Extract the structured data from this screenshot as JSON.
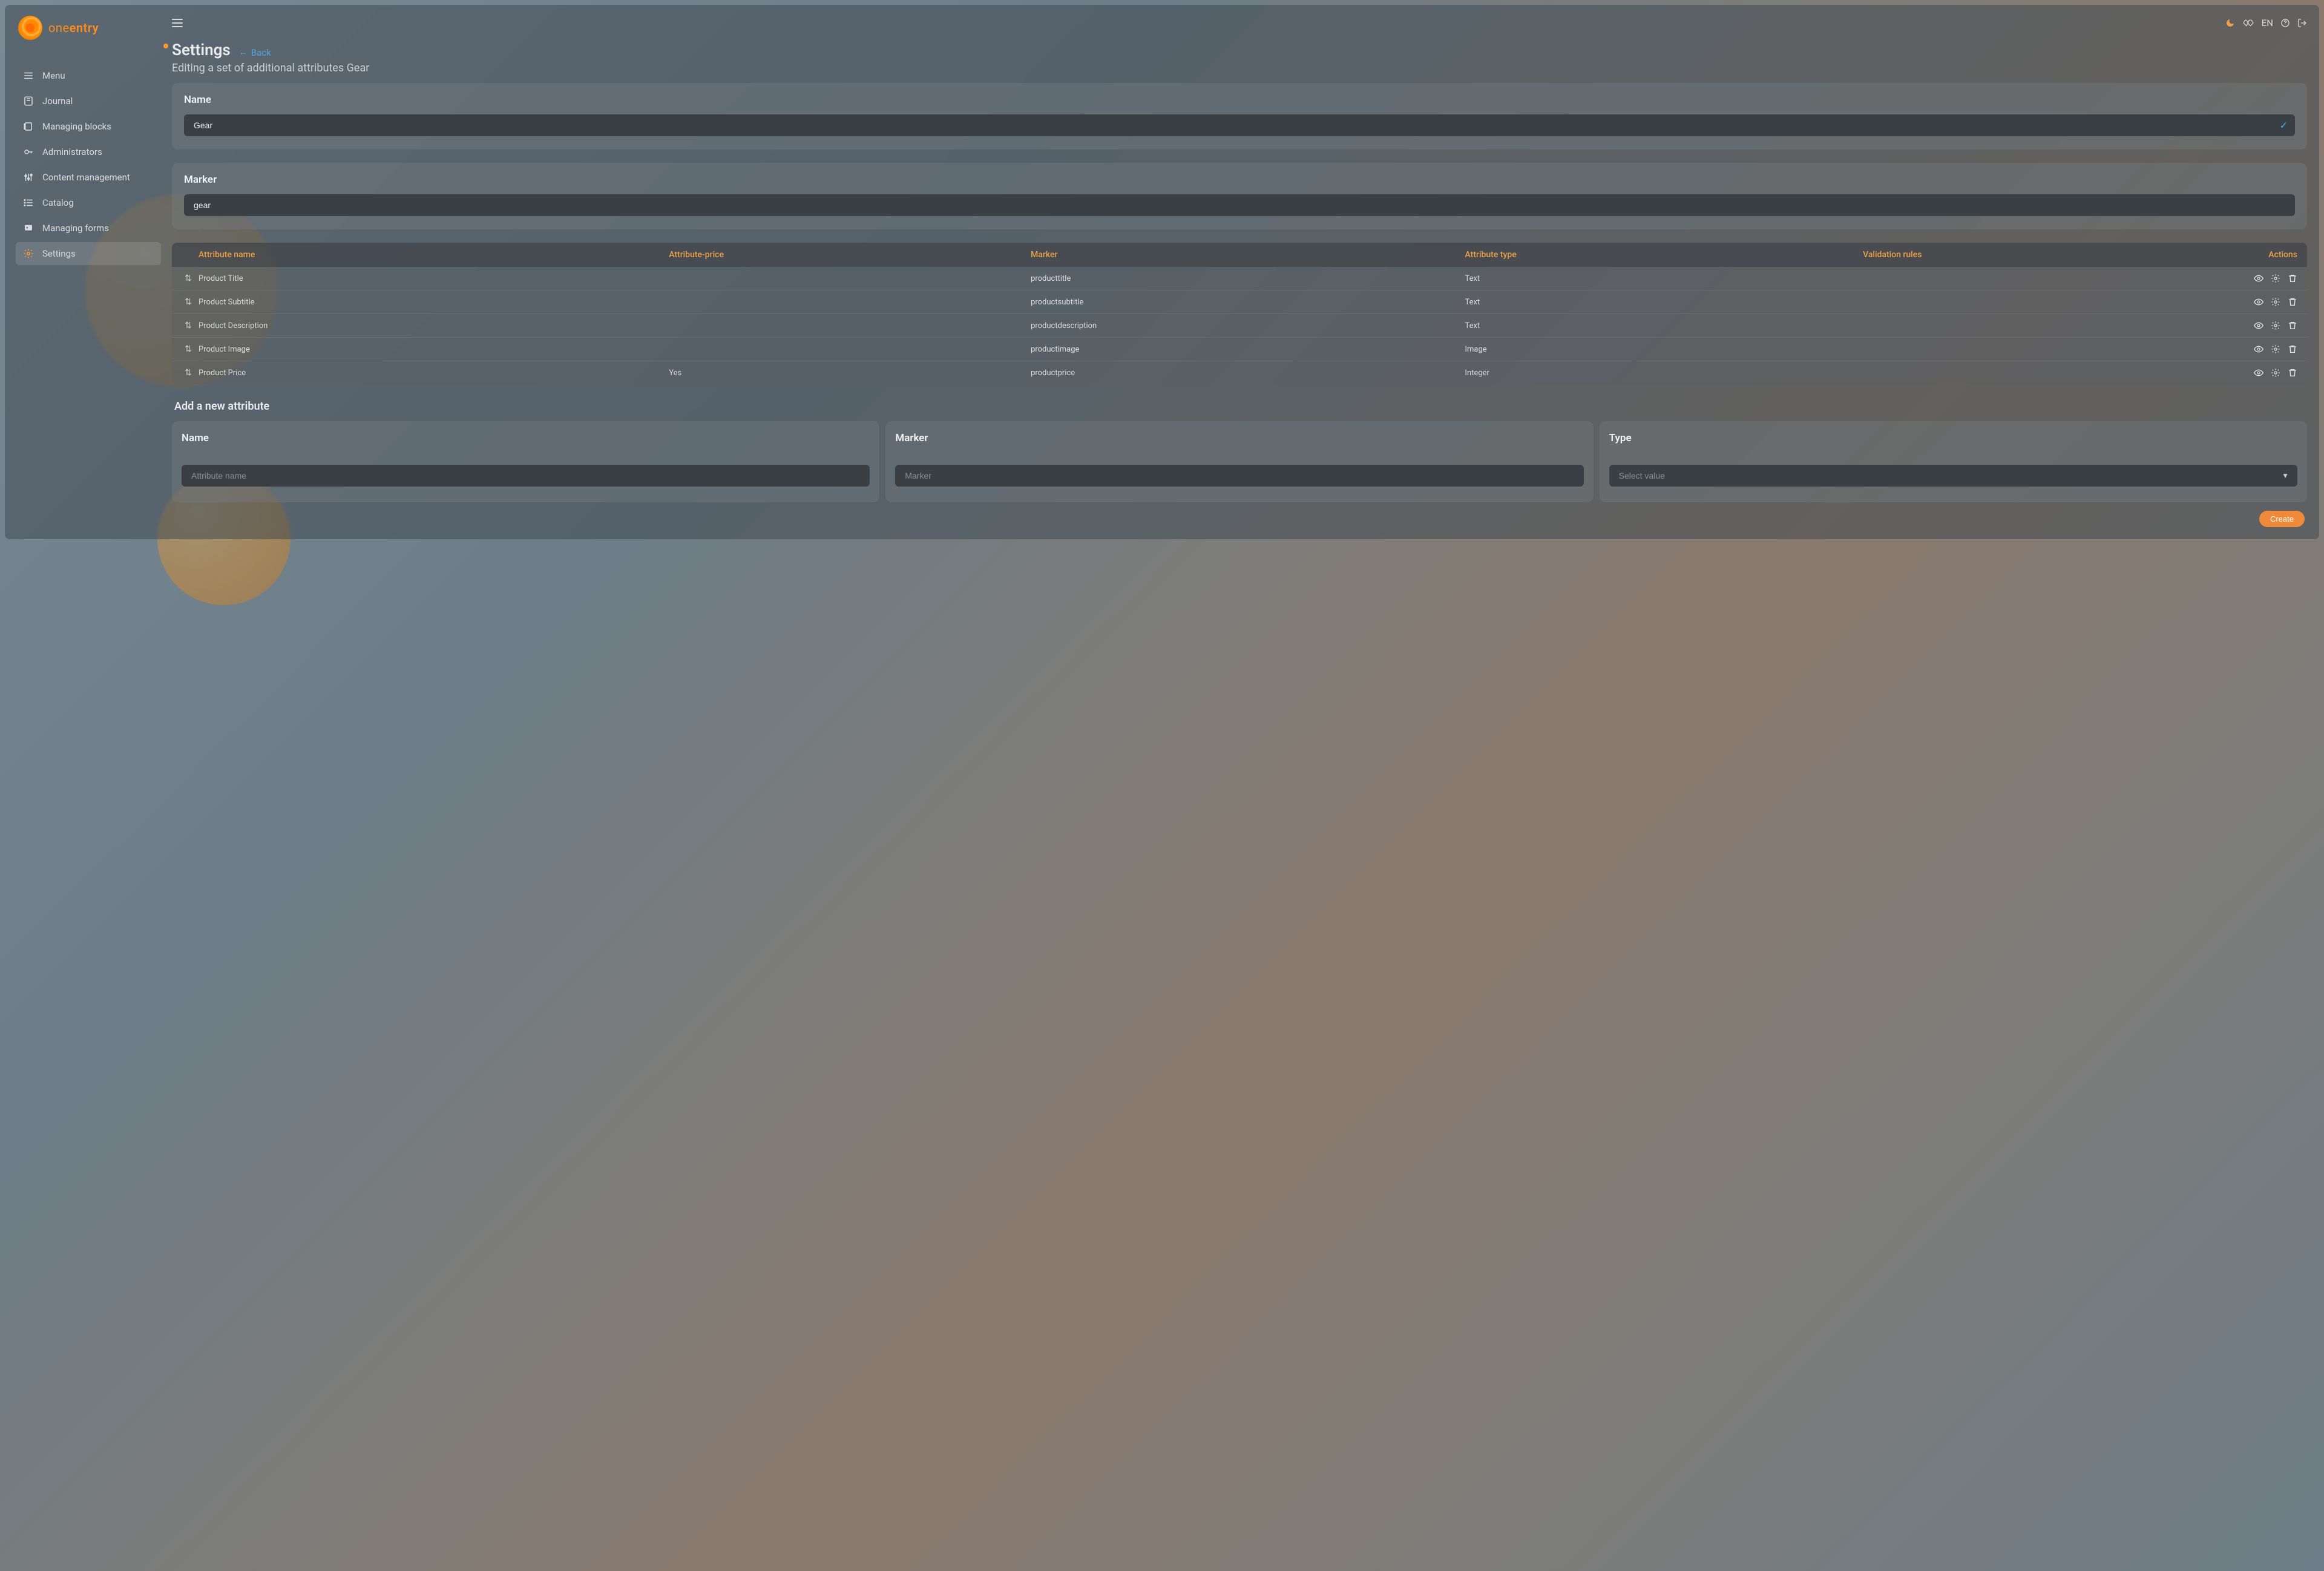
{
  "brand": {
    "name_a": "one",
    "name_b": "entry"
  },
  "lang": "EN",
  "sidebar": {
    "items": [
      {
        "label": "Menu"
      },
      {
        "label": "Journal"
      },
      {
        "label": "Managing blocks"
      },
      {
        "label": "Administrators"
      },
      {
        "label": "Content management"
      },
      {
        "label": "Catalog"
      },
      {
        "label": "Managing forms"
      },
      {
        "label": "Settings"
      }
    ]
  },
  "header": {
    "title": "Settings",
    "back": "Back",
    "subtitle": "Editing a set of additional attributes Gear"
  },
  "name_panel": {
    "label": "Name",
    "value": "Gear"
  },
  "marker_panel": {
    "label": "Marker",
    "value": "gear"
  },
  "table": {
    "columns": {
      "name": "Attribute name",
      "price": "Attribute-price",
      "marker": "Marker",
      "type": "Attribute type",
      "rules": "Validation rules",
      "actions": "Actions"
    },
    "rows": [
      {
        "name": "Product Title",
        "price": "",
        "marker": "producttitle",
        "type": "Text"
      },
      {
        "name": "Product Subtitle",
        "price": "",
        "marker": "productsubtitle",
        "type": "Text"
      },
      {
        "name": "Product Description",
        "price": "",
        "marker": "productdescription",
        "type": "Text"
      },
      {
        "name": "Product Image",
        "price": "",
        "marker": "productimage",
        "type": "Image"
      },
      {
        "name": "Product Price",
        "price": "Yes",
        "marker": "productprice",
        "type": "Integer"
      }
    ]
  },
  "new_attr": {
    "title": "Add a new attribute",
    "name_label": "Name",
    "name_placeholder": "Attribute name",
    "marker_label": "Marker",
    "marker_placeholder": "Marker",
    "type_label": "Type",
    "type_placeholder": "Select value"
  },
  "buttons": {
    "create": "Create"
  }
}
